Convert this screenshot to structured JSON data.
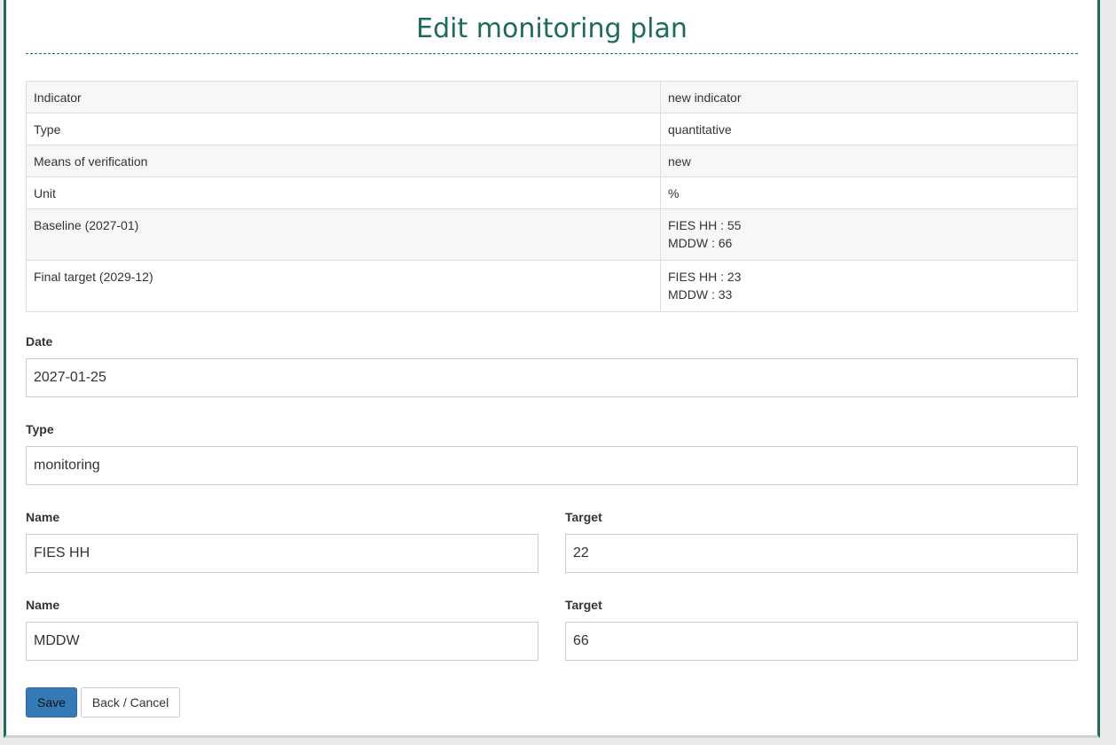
{
  "page": {
    "title": "Edit monitoring plan"
  },
  "info_table": {
    "rows": [
      {
        "label": "Indicator",
        "values": [
          "new indicator"
        ]
      },
      {
        "label": "Type",
        "values": [
          "quantitative"
        ]
      },
      {
        "label": "Means of verification",
        "values": [
          "new"
        ]
      },
      {
        "label": "Unit",
        "values": [
          "%"
        ]
      },
      {
        "label": "Baseline (2027-01)",
        "values": [
          "FIES HH : 55",
          "MDDW : 66"
        ]
      },
      {
        "label": "Final target (2029-12)",
        "values": [
          "FIES HH : 23",
          "MDDW : 33"
        ]
      }
    ]
  },
  "form": {
    "date": {
      "label": "Date",
      "value": "2027-01-25"
    },
    "type": {
      "label": "Type",
      "value": "monitoring"
    },
    "targets": [
      {
        "name_label": "Name",
        "name_value": "FIES HH",
        "target_label": "Target",
        "target_value": "22"
      },
      {
        "name_label": "Name",
        "name_value": "MDDW",
        "target_label": "Target",
        "target_value": "66"
      }
    ]
  },
  "buttons": {
    "save": "Save",
    "cancel": "Back / Cancel"
  },
  "colors": {
    "accent": "#1d6b5c",
    "primary_button": "#337ab7"
  }
}
